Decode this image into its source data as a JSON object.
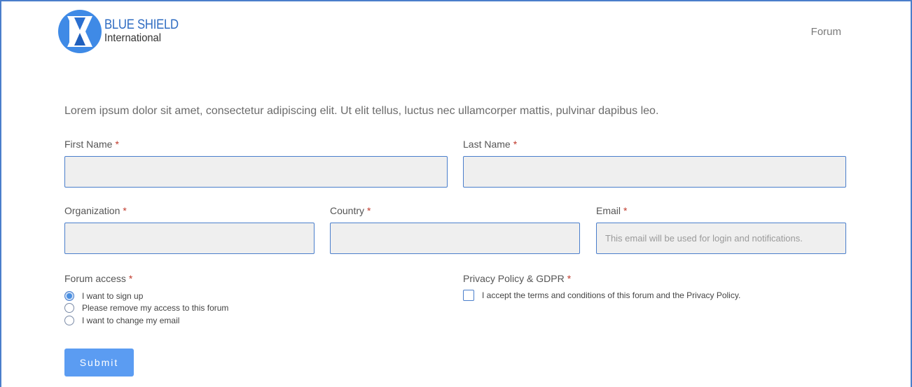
{
  "brand": {
    "line1": "BLUE SHIELD",
    "line2": "International",
    "colors": {
      "accent": "#2f6cc2",
      "primary_button": "#5b9cf2",
      "border": "#4a7ecb"
    }
  },
  "nav": {
    "forum_label": "Forum"
  },
  "intro_text": "Lorem ipsum dolor sit amet, consectetur adipiscing elit. Ut elit tellus, luctus nec ullamcorper mattis, pulvinar dapibus leo.",
  "required_marker": "*",
  "fields": {
    "first_name": {
      "label": "First Name",
      "value": "",
      "placeholder": ""
    },
    "last_name": {
      "label": "Last Name",
      "value": "",
      "placeholder": ""
    },
    "organization": {
      "label": "Organization",
      "value": "",
      "placeholder": ""
    },
    "country": {
      "label": "Country",
      "value": "",
      "placeholder": ""
    },
    "email": {
      "label": "Email",
      "value": "",
      "placeholder": "This email will be used for login and notifications."
    }
  },
  "forum_access": {
    "label": "Forum access",
    "options": [
      {
        "label": "I want to sign up",
        "selected": true
      },
      {
        "label": "Please remove my access to this forum",
        "selected": false
      },
      {
        "label": "I want to change my email",
        "selected": false
      }
    ]
  },
  "privacy": {
    "label": "Privacy Policy & GDPR",
    "checkbox_label": "I accept the terms and conditions of this forum and the Privacy Policy.",
    "checked": false
  },
  "submit_label": "Submit"
}
